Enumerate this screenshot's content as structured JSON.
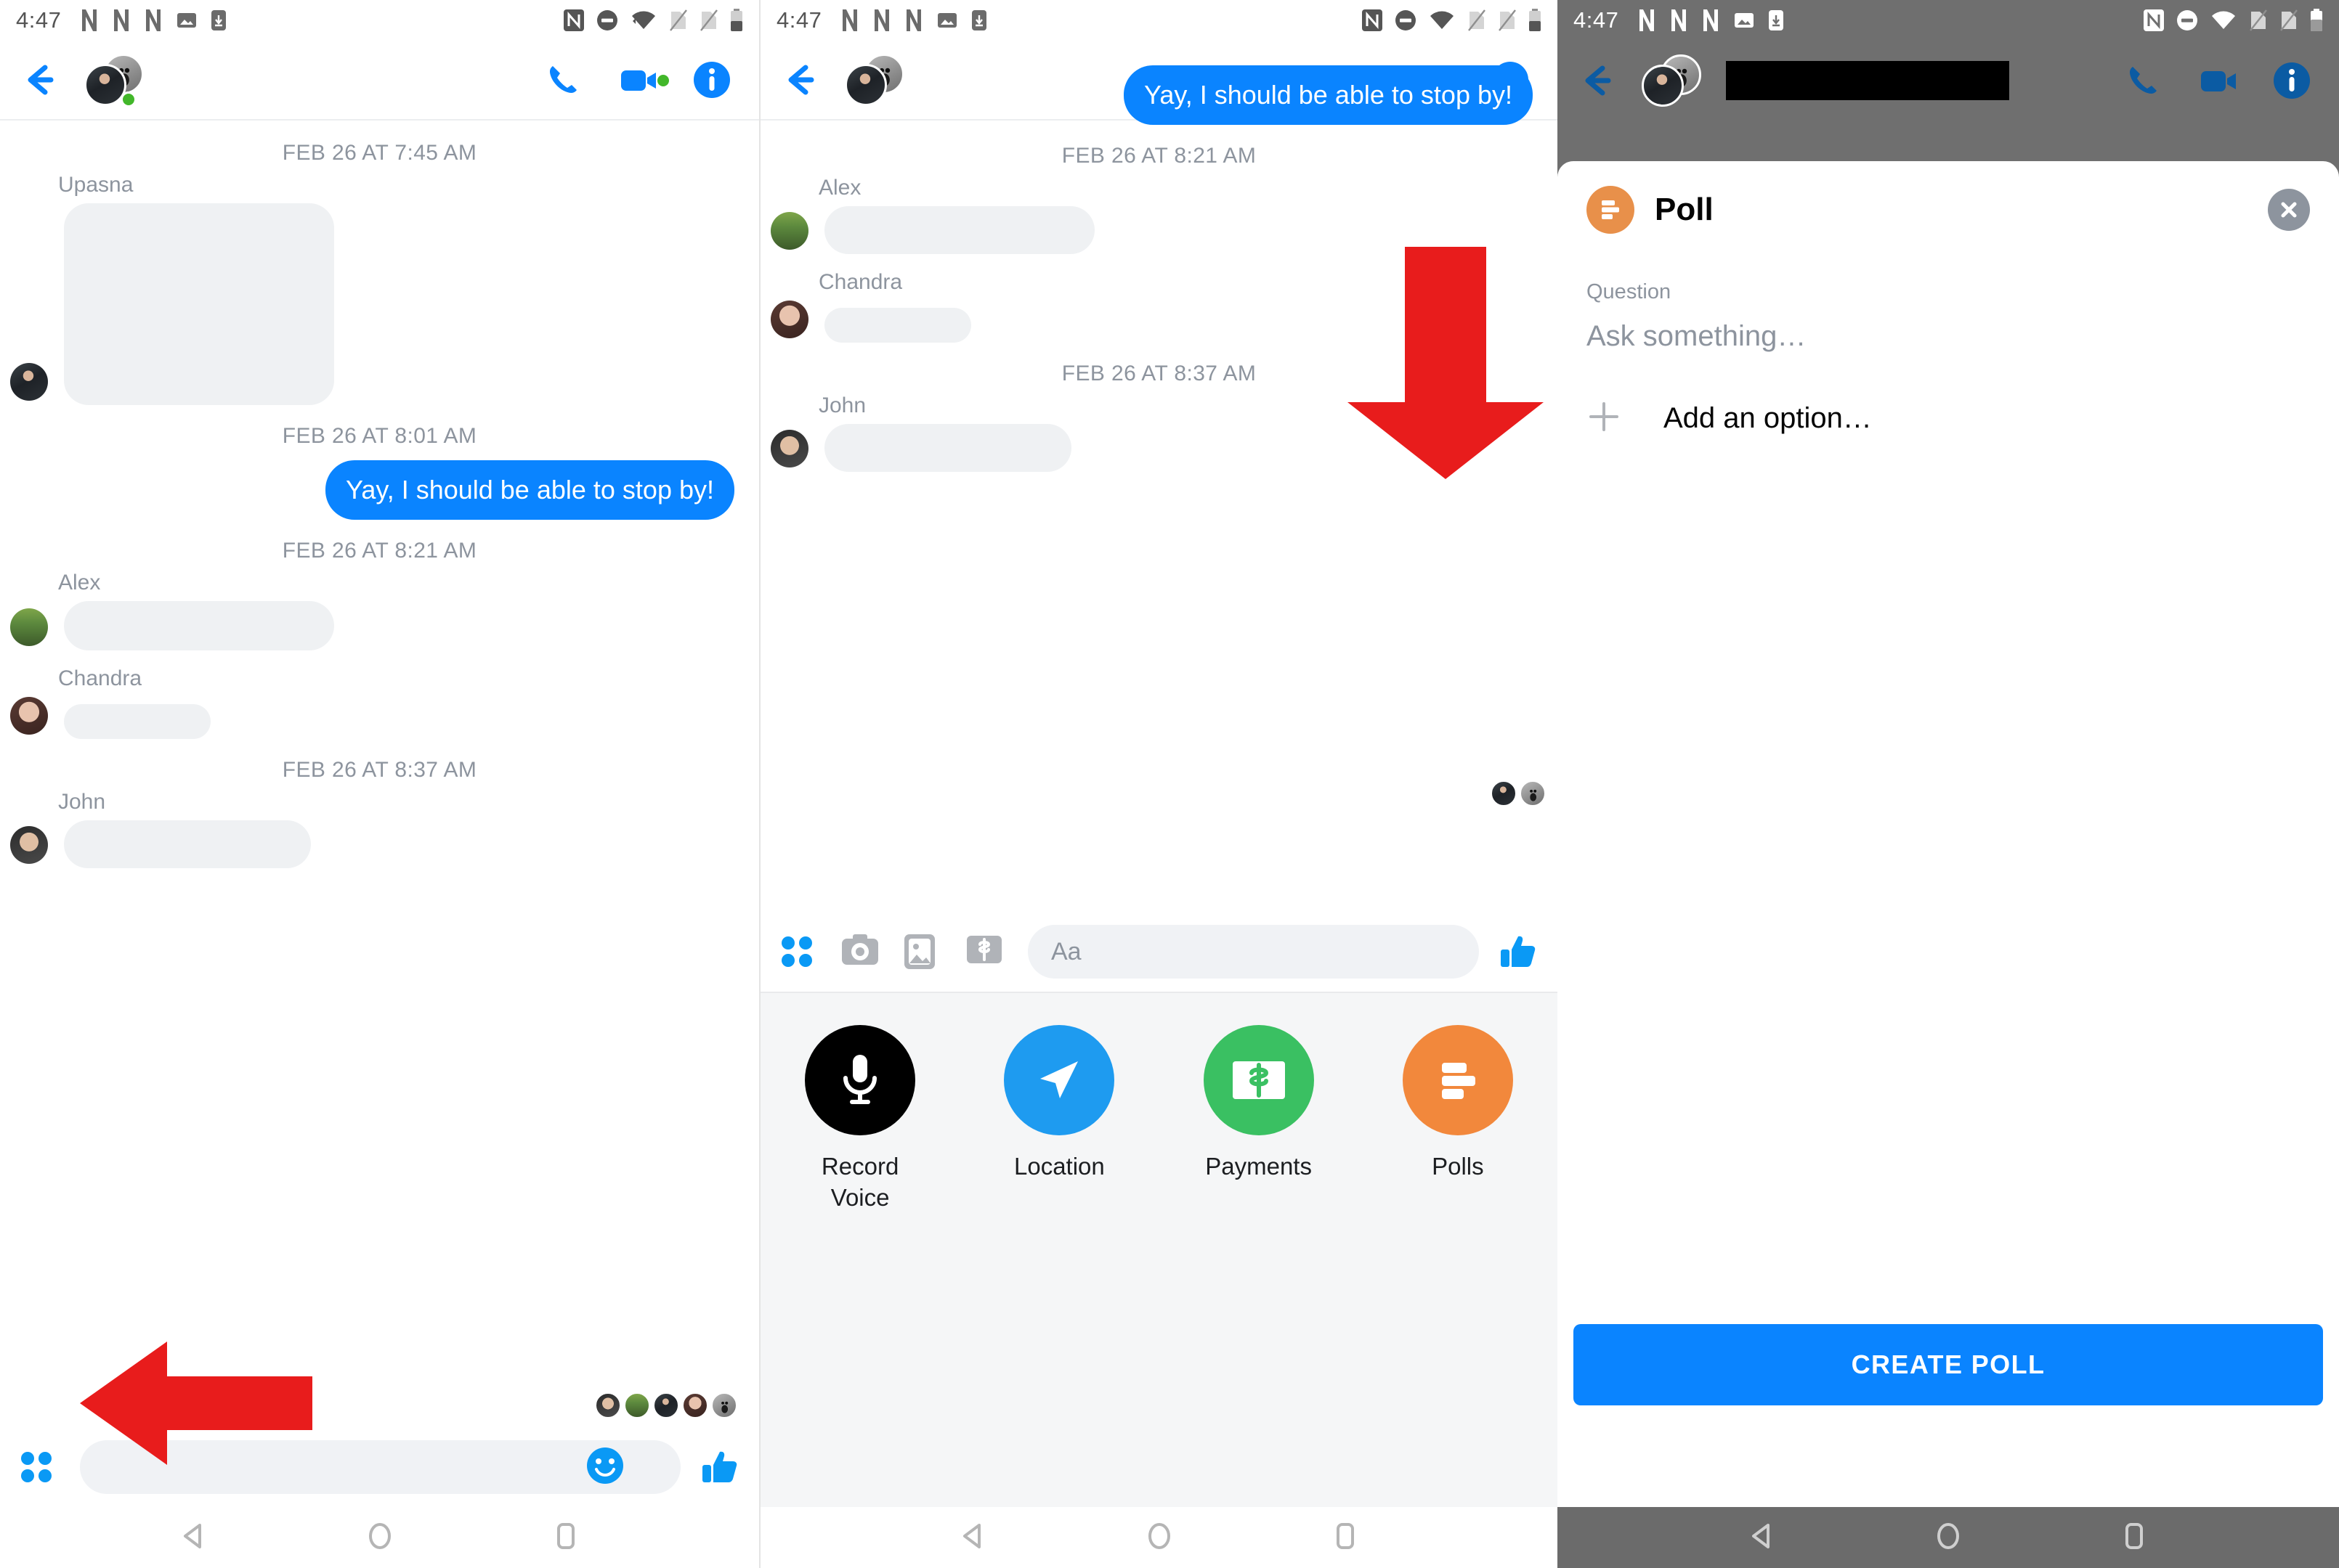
{
  "statusbar": {
    "time": "4:47",
    "left_icons": [
      "n-logo-icon",
      "n-logo-icon",
      "n-logo-icon",
      "image-icon",
      "download-icon"
    ],
    "right_icons": [
      "nfc-icon",
      "dnd-icon",
      "wifi-icon",
      "sim1-off-icon",
      "sim2-off-icon",
      "battery-icon"
    ]
  },
  "header": {
    "back_icon": "back-arrow-icon",
    "call_icon": "phone-icon",
    "video_icon": "video-camera-icon",
    "info_icon": "info-icon",
    "redacted_name": ""
  },
  "panel1": {
    "thread": [
      {
        "type": "separator",
        "text": "FEB 26 AT 7:45 AM"
      },
      {
        "type": "incoming",
        "sender": "Upasna",
        "avatar": "upasna",
        "bubble_w": 740,
        "bubble_h": 190
      },
      {
        "type": "separator",
        "text": "FEB 26 AT 8:01 AM"
      },
      {
        "type": "outgoing",
        "text": "Yay, I should be able to stop by!"
      },
      {
        "type": "separator",
        "text": "FEB 26 AT 8:21 AM"
      },
      {
        "type": "incoming",
        "sender": "Alex",
        "avatar": "alex",
        "bubble_w": 740,
        "bubble_h": 110
      },
      {
        "type": "incoming",
        "sender": "Chandra",
        "avatar": "chandra",
        "bubble_w": 400,
        "bubble_h": 68
      },
      {
        "type": "separator",
        "text": "FEB 26 AT 8:37 AM"
      },
      {
        "type": "incoming",
        "sender": "John",
        "avatar": "john",
        "bubble_w": 678,
        "bubble_h": 100
      }
    ],
    "seen_by": [
      "john",
      "alex",
      "upasna",
      "chandra",
      "moon"
    ],
    "composer": {
      "apps_icon": "four-dots-apps-icon",
      "emoji_icon": "smiley-icon",
      "thumb_icon": "thumbs-up-icon",
      "placeholder": ""
    },
    "annotation": {
      "arrow": "left-pointing-red-arrow",
      "points_to": "four-dots-apps-icon"
    }
  },
  "panel2": {
    "thread": [
      {
        "type": "outgoing",
        "text": "Yay, I should be able to stop by!"
      },
      {
        "type": "separator",
        "text": "FEB 26 AT 8:21 AM"
      },
      {
        "type": "incoming",
        "sender": "Alex",
        "avatar": "alex",
        "bubble_w": 740,
        "bubble_h": 100
      },
      {
        "type": "incoming",
        "sender": "Chandra",
        "avatar": "chandra",
        "bubble_w": 400,
        "bubble_h": 68
      },
      {
        "type": "separator",
        "text": "FEB 26 AT 8:37 AM"
      },
      {
        "type": "incoming",
        "sender": "John",
        "avatar": "john",
        "bubble_w": 678,
        "bubble_h": 100
      }
    ],
    "seen_by": [
      "upasna",
      "moon"
    ],
    "composer": {
      "apps_icon": "four-dots-apps-icon",
      "camera_icon": "camera-icon",
      "gallery_icon": "gallery-icon",
      "payment_icon": "dollar-bill-icon",
      "placeholder": "Aa",
      "thumb_icon": "thumbs-up-icon"
    },
    "tray": [
      {
        "label": "Record\nVoice",
        "icon": "microphone-icon",
        "color": "#000000"
      },
      {
        "label": "Location",
        "icon": "location-arrow-icon",
        "color": "#1e9bf0"
      },
      {
        "label": "Payments",
        "icon": "dollar-bill-icon",
        "color": "#3ac062"
      },
      {
        "label": "Polls",
        "icon": "poll-bars-icon",
        "color": "#f2883c"
      }
    ],
    "annotation": {
      "arrow": "down-pointing-red-arrow",
      "points_to": "polls-tray-item"
    }
  },
  "panel3": {
    "sheet": {
      "title": "Poll",
      "badge_icon": "poll-bars-icon",
      "close_icon": "close-x-icon",
      "question_label": "Question",
      "question_placeholder": "Ask something…",
      "add_option_icon": "plus-icon",
      "add_option_label": "Add an option…",
      "create_button": "CREATE POLL"
    }
  },
  "navbar": {
    "back_icon": "triangle-back-icon",
    "home_icon": "circle-home-icon",
    "recents_icon": "square-recents-icon"
  },
  "colors": {
    "messenger_blue": "#0a84ff",
    "annotation_red": "#e81c1c",
    "poll_orange": "#f2883c",
    "payments_green": "#3ac062",
    "online_green": "#42b72a",
    "bubble_grey": "#eff1f3",
    "dim_grey": "#6f6f6f"
  }
}
